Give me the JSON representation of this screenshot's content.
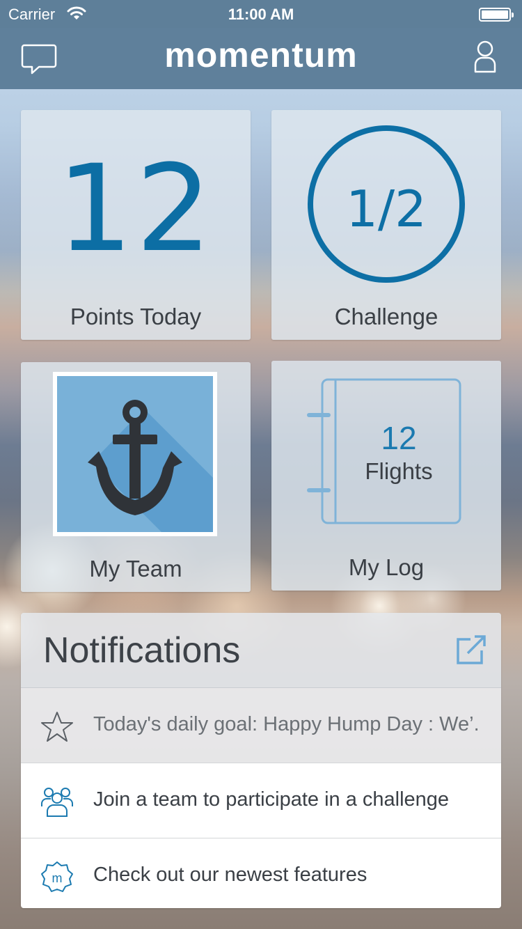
{
  "status_bar": {
    "carrier": "Carrier",
    "time": "11:00 AM"
  },
  "nav": {
    "title": "momentum",
    "left_icon": "chat-bubble-icon",
    "right_icon": "user-profile-icon"
  },
  "tiles": {
    "points": {
      "value": "12",
      "label": "Points Today"
    },
    "challenge": {
      "value": "1/2",
      "label": "Challenge"
    },
    "team": {
      "label": "My Team",
      "avatar_icon": "anchor-icon"
    },
    "log": {
      "count": "12",
      "unit": "Flights",
      "label": "My Log"
    }
  },
  "notifications": {
    "title": "Notifications",
    "open_icon": "external-link-icon",
    "items": [
      {
        "icon": "star-icon",
        "text": "Today's daily goal: Happy Hump Day : We’..."
      },
      {
        "icon": "team-icon",
        "text": "Join a team to participate in a challenge"
      },
      {
        "icon": "momentum-badge-icon",
        "text": "Check out our newest features"
      }
    ]
  },
  "colors": {
    "accent": "#0d6fa5",
    "navbar": "#5e7f99",
    "log_icon": "#7fb3d8"
  }
}
